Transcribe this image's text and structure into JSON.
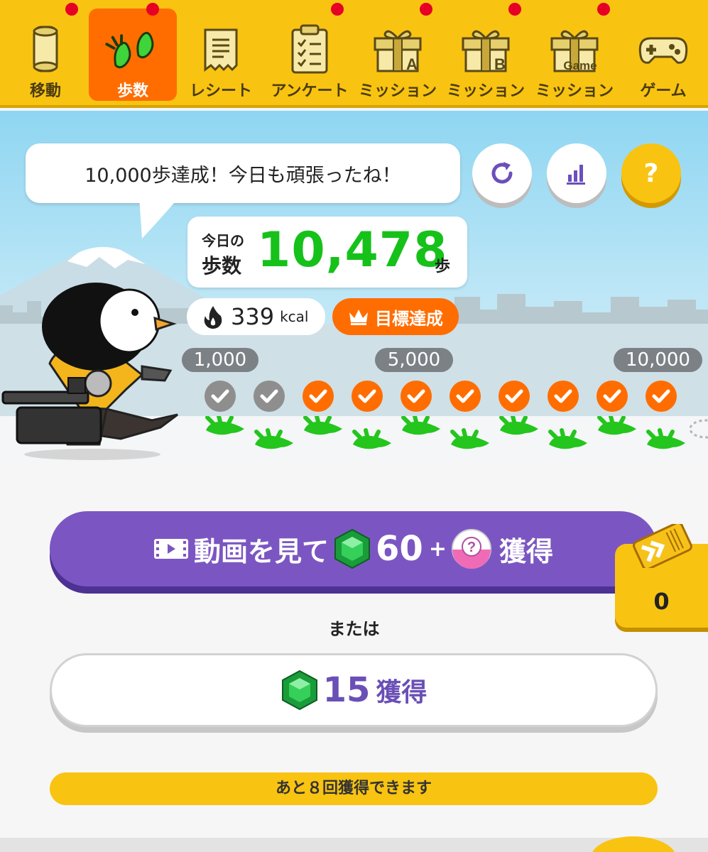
{
  "tabs": [
    {
      "label": "移動",
      "icon": "capsule-icon",
      "badge": true,
      "active": false
    },
    {
      "label": "歩数",
      "icon": "footprints-icon",
      "badge": true,
      "active": true
    },
    {
      "label": "レシート",
      "icon": "receipt-icon",
      "badge": false,
      "active": false
    },
    {
      "label": "アンケート",
      "icon": "clipboard-icon",
      "badge": true,
      "active": false
    },
    {
      "label": "ミッション",
      "icon": "gift-a-icon",
      "gift_letter": "A",
      "badge": true,
      "active": false
    },
    {
      "label": "ミッション",
      "icon": "gift-b-icon",
      "gift_letter": "B",
      "badge": true,
      "active": false
    },
    {
      "label": "ミッション",
      "icon": "gift-game-icon",
      "gift_letter": "Game",
      "badge": true,
      "active": false
    },
    {
      "label": "ゲーム",
      "icon": "gamepad-icon",
      "badge": false,
      "active": false
    }
  ],
  "message": "10,000歩達成！今日も頑張ったね！",
  "action_buttons": {
    "refresh": "refresh-icon",
    "stats": "bar-chart-icon",
    "help": "?"
  },
  "steps": {
    "label_line1": "今日の",
    "label_line2": "歩数",
    "value": "10,478",
    "unit": "歩"
  },
  "calories": {
    "value": "339",
    "unit": "kcal"
  },
  "goal_badge": "目標達成",
  "progress": {
    "labels": [
      "1,000",
      "5,000",
      "10,000"
    ],
    "checkpoints": [
      "gray",
      "gray",
      "orange",
      "orange",
      "orange",
      "orange",
      "orange",
      "orange",
      "orange",
      "orange"
    ]
  },
  "video_button": {
    "text": "動画を見て",
    "gems": "60",
    "plus": "+",
    "suffix": "獲得"
  },
  "ticket": {
    "count": "0"
  },
  "or_text": "または",
  "gem_button": {
    "amount": "15",
    "label": "獲得"
  },
  "remaining_text": "あと８回獲得できます",
  "colors": {
    "brand_yellow": "#f9c312",
    "active_orange": "#ff6d00",
    "steps_green": "#16c11a",
    "purple": "#7b56c2"
  }
}
